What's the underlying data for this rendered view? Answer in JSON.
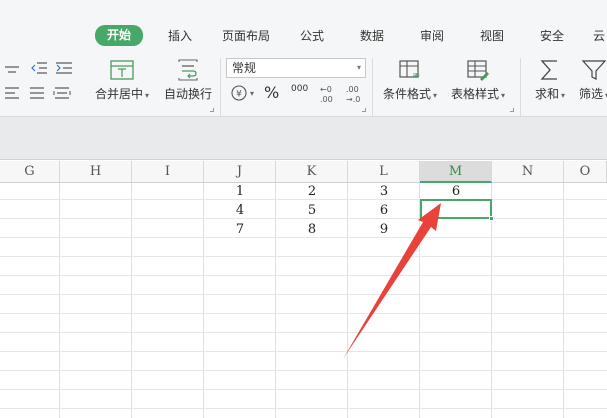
{
  "tabs": [
    {
      "label": "开始",
      "active": true
    },
    {
      "label": "插入"
    },
    {
      "label": "页面布局"
    },
    {
      "label": "公式"
    },
    {
      "label": "数据"
    },
    {
      "label": "审阅"
    },
    {
      "label": "视图"
    },
    {
      "label": "安全"
    },
    {
      "label": "云"
    }
  ],
  "toolbar": {
    "merge_center": "合并居中",
    "wrap_text": "自动换行",
    "number_format": "常规",
    "conditional_format": "条件格式",
    "table_style": "表格样式",
    "sum": "求和",
    "filter": "筛选",
    "percent_symbol": "%",
    "thousands_symbol": "000",
    "dec_inc_label": "+0 .00",
    "dec_dec_label": ".00 →.0"
  },
  "columns": [
    "G",
    "H",
    "I",
    "J",
    "K",
    "L",
    "M",
    "N",
    "O"
  ],
  "selected_column": "M",
  "cells": {
    "J1": "1",
    "K1": "2",
    "L1": "3",
    "M1": "6",
    "J2": "4",
    "K2": "5",
    "L2": "6",
    "J3": "7",
    "K3": "8",
    "L3": "9"
  },
  "colors": {
    "accent": "#47a867",
    "arrow": "#e8423a",
    "ribbon_bg": "#f5f6f7"
  }
}
